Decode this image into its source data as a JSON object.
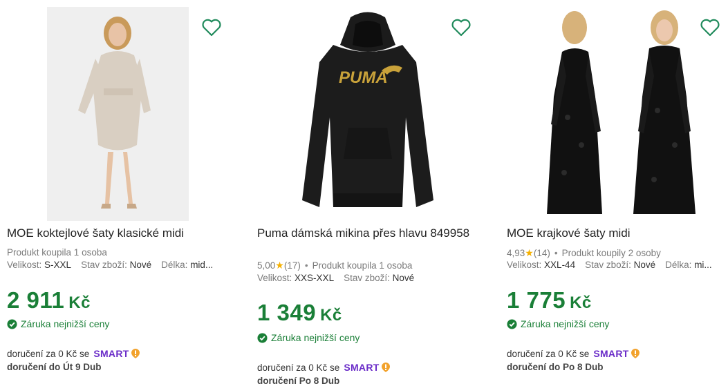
{
  "colors": {
    "price": "#1a7f37",
    "heart": "#1f8a5b",
    "smart": "#6a2cc8",
    "smart_accent": "#f2a22c",
    "star": "#f5b000"
  },
  "products": [
    {
      "title": "MOE koktejlové šaty klasické midi",
      "bought": "Produkt koupila 1 osoba",
      "size_label": "Velikost:",
      "size": "S-XXL",
      "cond_label": "Stav zboží:",
      "cond": "Nové",
      "len_label": "Délka:",
      "len": "mid...",
      "price": "2 911",
      "currency": "Kč",
      "guarantee": "Záruka nejnižší ceny",
      "delivery": "doručení za 0 Kč se",
      "smart": "SMART",
      "date": "doručení do Út 9 Dub"
    },
    {
      "title": "Puma dámská mikina přes hlavu 849958",
      "rating": "5,00",
      "reviews": "(17)",
      "bought": "Produkt koupila 1 osoba",
      "size_label": "Velikost:",
      "size": "XXS-XXL",
      "cond_label": "Stav zboží:",
      "cond": "Nové",
      "price": "1 349",
      "currency": "Kč",
      "guarantee": "Záruka nejnižší ceny",
      "delivery": "doručení za 0 Kč se",
      "smart": "SMART",
      "date": "doručení Po 8 Dub"
    },
    {
      "title": "MOE krajkové šaty midi",
      "rating": "4,93",
      "reviews": "(14)",
      "bought": "Produkt koupily 2 osoby",
      "size_label": "Velikost:",
      "size": "XXL-44",
      "cond_label": "Stav zboží:",
      "cond": "Nové",
      "len_label": "Délka:",
      "len": "mi...",
      "price": "1 775",
      "currency": "Kč",
      "guarantee": "Záruka nejnižší ceny",
      "delivery": "doručení za 0 Kč se",
      "smart": "SMART",
      "date": "doručení do Po 8 Dub"
    }
  ]
}
